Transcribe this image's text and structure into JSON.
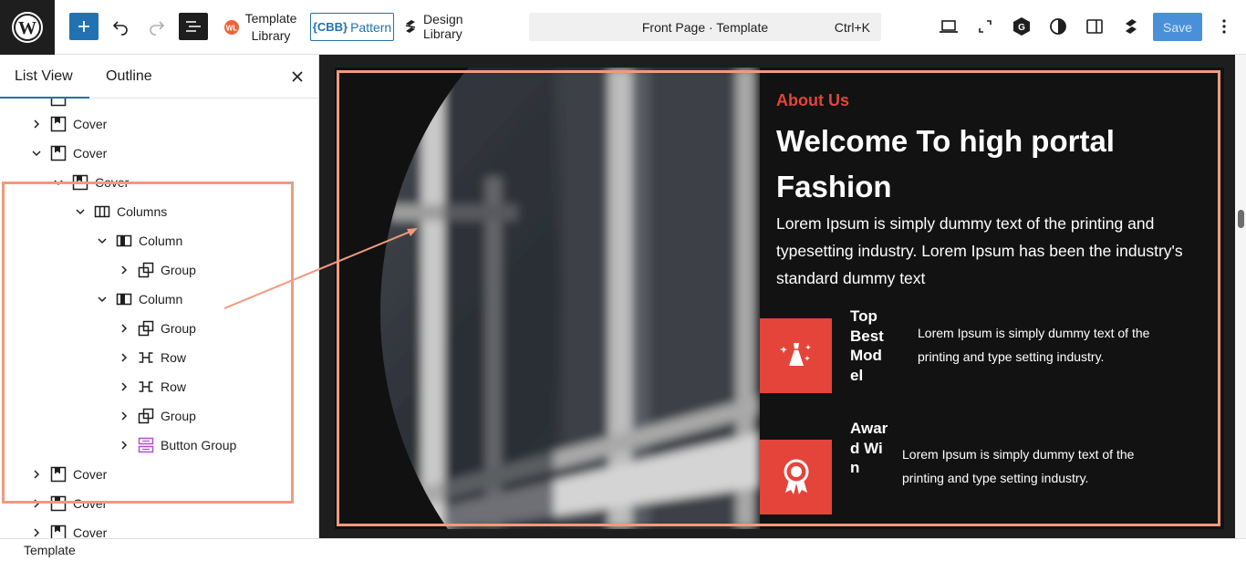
{
  "toolbar": {
    "template_library_line1": "Template",
    "template_library_line2": "Library",
    "cbb_tag": "CBB",
    "pattern_label": "Pattern",
    "design_library_label": "Design Library",
    "command_title": "Front Page · Template",
    "command_shortcut": "Ctrl+K",
    "save_label": "Save"
  },
  "sidebar": {
    "tabs": [
      {
        "label": "List View",
        "active": true
      },
      {
        "label": "Outline",
        "active": false
      }
    ],
    "tree": [
      {
        "label": "Cover",
        "icon": "cover-icon",
        "chevron": "right"
      },
      {
        "label": "Cover",
        "icon": "cover-icon",
        "chevron": "down"
      },
      {
        "label": "Cover",
        "icon": "cover-icon",
        "chevron": "down"
      },
      {
        "label": "Columns",
        "icon": "columns-icon",
        "chevron": "down"
      },
      {
        "label": "Column",
        "icon": "column-icon",
        "chevron": "down"
      },
      {
        "label": "Group",
        "icon": "group-icon",
        "chevron": "right"
      },
      {
        "label": "Column",
        "icon": "column-icon",
        "chevron": "down"
      },
      {
        "label": "Group",
        "icon": "group-icon",
        "chevron": "right"
      },
      {
        "label": "Row",
        "icon": "row-icon",
        "chevron": "right"
      },
      {
        "label": "Row",
        "icon": "row-icon",
        "chevron": "right"
      },
      {
        "label": "Group",
        "icon": "group-icon",
        "chevron": "right"
      },
      {
        "label": "Button Group",
        "icon": "button-group-icon",
        "chevron": "right"
      },
      {
        "label": "Cover",
        "icon": "cover-icon",
        "chevron": "right"
      },
      {
        "label": "Cover",
        "icon": "cover-icon",
        "chevron": "right"
      },
      {
        "label": "Cover",
        "icon": "cover-icon",
        "chevron": "right"
      }
    ]
  },
  "canvas": {
    "about_label": "About Us",
    "heading": "Welcome To high portal Fashion",
    "lead": "Lorem Ipsum is simply dummy text of the printing and typesetting industry. Lorem Ipsum has been the industry's standard dummy text",
    "features": [
      {
        "title": "Top Best Model",
        "desc": "Lorem Ipsum is simply dummy text of the printing and type setting industry.",
        "icon": "dress-icon"
      },
      {
        "title": "Award Win",
        "desc": "Lorem Ipsum is simply dummy text of the printing and type setting industry.",
        "icon": "award-icon"
      }
    ]
  },
  "footer": {
    "breadcrumb": "Template"
  },
  "colors": {
    "accent": "#e4443a",
    "highlight": "#f09a7e",
    "wp_blue": "#2271b1"
  }
}
